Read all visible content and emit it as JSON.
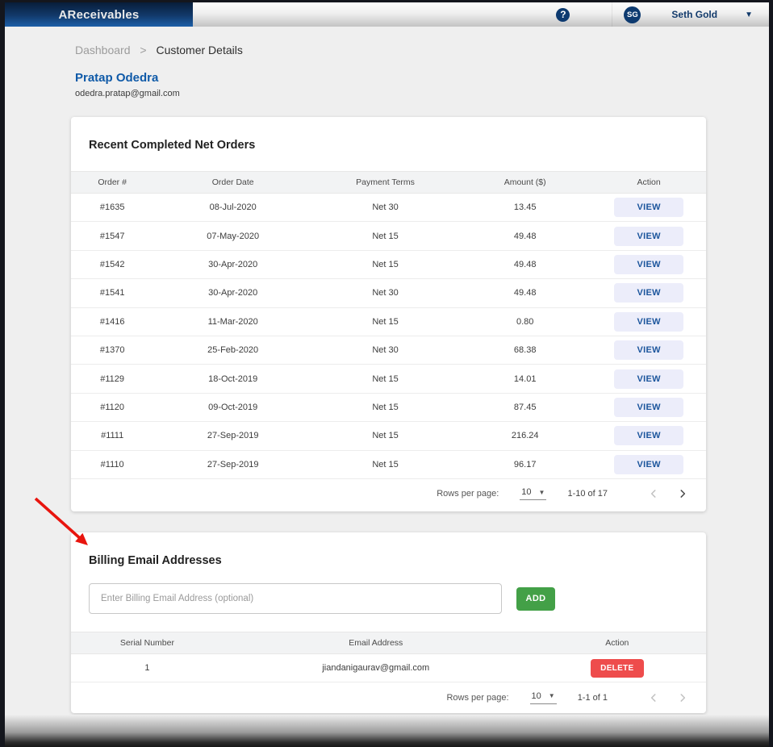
{
  "header": {
    "brand": "AReceivables",
    "help_icon": "?",
    "avatar_initials": "SG",
    "user_name": "Seth Gold",
    "caret_icon": "▼"
  },
  "breadcrumb": {
    "parent": "Dashboard",
    "separator": ">",
    "current": "Customer Details"
  },
  "customer": {
    "name": "Pratap Odedra",
    "email": "odedra.pratap@gmail.com"
  },
  "orders_card": {
    "title": "Recent Completed Net Orders",
    "columns": [
      "Order #",
      "Order Date",
      "Payment Terms",
      "Amount ($)",
      "Action"
    ],
    "action_label": "VIEW",
    "rows": [
      {
        "order": "#1635",
        "date": "08-Jul-2020",
        "terms": "Net 30",
        "amount": "13.45"
      },
      {
        "order": "#1547",
        "date": "07-May-2020",
        "terms": "Net 15",
        "amount": "49.48"
      },
      {
        "order": "#1542",
        "date": "30-Apr-2020",
        "terms": "Net 15",
        "amount": "49.48"
      },
      {
        "order": "#1541",
        "date": "30-Apr-2020",
        "terms": "Net 30",
        "amount": "49.48"
      },
      {
        "order": "#1416",
        "date": "11-Mar-2020",
        "terms": "Net 15",
        "amount": "0.80"
      },
      {
        "order": "#1370",
        "date": "25-Feb-2020",
        "terms": "Net 30",
        "amount": "68.38"
      },
      {
        "order": "#1129",
        "date": "18-Oct-2019",
        "terms": "Net 15",
        "amount": "14.01"
      },
      {
        "order": "#1120",
        "date": "09-Oct-2019",
        "terms": "Net 15",
        "amount": "87.45"
      },
      {
        "order": "#1111",
        "date": "27-Sep-2019",
        "terms": "Net 15",
        "amount": "216.24"
      },
      {
        "order": "#1110",
        "date": "27-Sep-2019",
        "terms": "Net 15",
        "amount": "96.17"
      }
    ],
    "pagination": {
      "label": "Rows per page:",
      "per_page": "10",
      "caret": "▼",
      "range": "1-10 of 17",
      "prev_enabled": false,
      "next_enabled": true
    }
  },
  "billing_card": {
    "title": "Billing Email Addresses",
    "input_value": "",
    "input_placeholder": "Enter Billing Email Address (optional)",
    "add_label": "ADD",
    "columns": [
      "Serial Number",
      "Email Address",
      "Action"
    ],
    "delete_label": "DELETE",
    "rows": [
      {
        "serial": "1",
        "email": "jiandanigaurav@gmail.com"
      }
    ],
    "pagination": {
      "label": "Rows per page:",
      "per_page": "10",
      "caret": "▼",
      "range": "1-1 of 1",
      "prev_enabled": false,
      "next_enabled": false
    }
  },
  "annotation": {
    "type": "red-arrow",
    "color": "#e8150e",
    "points_to": "Billing Email Addresses title"
  },
  "colors": {
    "brand_gradient_top": "#081d3a",
    "brand_gradient_bottom": "#1c5fa8",
    "navy_accent": "#0d3a70",
    "link_blue": "#0f5aa8",
    "view_button_bg": "#ecedfa",
    "view_button_text": "#1b559c",
    "add_button": "#43a047",
    "delete_button": "#ee4c4c",
    "page_background": "#efefef",
    "table_header_bg": "#f2f3f4"
  }
}
